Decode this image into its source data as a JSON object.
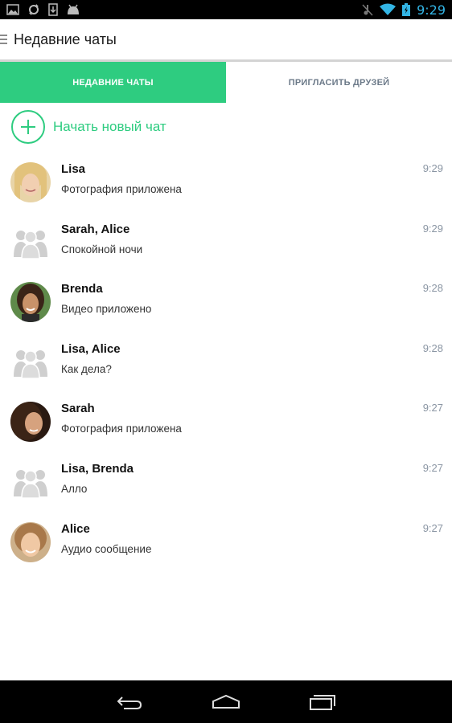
{
  "status_bar": {
    "time": "9:29",
    "icons_left": [
      "image-icon",
      "sync-icon",
      "download-icon",
      "android-icon"
    ],
    "icons_right": [
      "mute-icon",
      "wifi-icon",
      "battery-icon"
    ]
  },
  "action_bar": {
    "title": "Недавние чаты"
  },
  "tabs": [
    {
      "label": "НЕДАВНИЕ ЧАТЫ",
      "active": true
    },
    {
      "label": "ПРИГЛАСИТЬ ДРУЗЕЙ",
      "active": false
    }
  ],
  "new_chat": {
    "label": "Начать новый чат"
  },
  "chats": [
    {
      "name": "Lisa",
      "message": "Фотография приложена",
      "time": "9:29",
      "avatar": "photo",
      "avatar_color": "#d9b98a"
    },
    {
      "name": "Sarah, Alice",
      "message": "Спокойной ночи",
      "time": "9:29",
      "avatar": "group"
    },
    {
      "name": "Brenda",
      "message": "Видео приложено",
      "time": "9:28",
      "avatar": "photo",
      "avatar_color": "#6a4632"
    },
    {
      "name": "Lisa, Alice",
      "message": "Как дела?",
      "time": "9:28",
      "avatar": "group"
    },
    {
      "name": "Sarah",
      "message": "Фотография приложена",
      "time": "9:27",
      "avatar": "photo",
      "avatar_color": "#5a3a2a"
    },
    {
      "name": "Lisa, Brenda",
      "message": "Алло",
      "time": "9:27",
      "avatar": "group"
    },
    {
      "name": "Alice",
      "message": "Аудио сообщение",
      "time": "9:27",
      "avatar": "photo",
      "avatar_color": "#c89a6a"
    }
  ],
  "colors": {
    "accent": "#2ecc80",
    "time_text": "#8a95a3",
    "status_time": "#33b5e5"
  }
}
